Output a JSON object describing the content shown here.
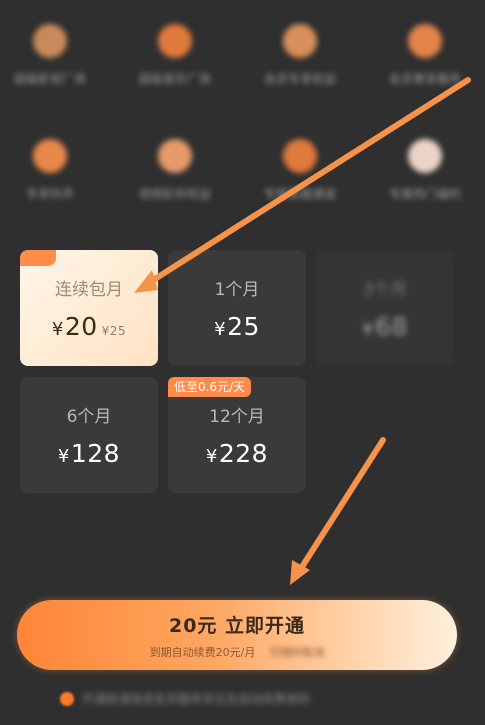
{
  "benefits": [
    {
      "label": "超级影视厂商",
      "color": "#c88a5a"
    },
    {
      "label": "超级音乐厂商",
      "color": "#e07a3c"
    },
    {
      "label": "会员专享权益",
      "color": "#d98f5a"
    },
    {
      "label": "会员尊享服务",
      "color": "#e3834a"
    },
    {
      "label": "专享铃声",
      "color": "#e8874a"
    },
    {
      "label": "视频彩铃权益",
      "color": "#e69a6a"
    },
    {
      "label": "专属客服通道",
      "color": "#e07a3c"
    },
    {
      "label": "专属热门福利",
      "color": "#ead4c6"
    }
  ],
  "plans": [
    {
      "name": "连续包月",
      "currency": "¥",
      "price": "20",
      "original": "¥25"
    },
    {
      "name": "1个月",
      "currency": "¥",
      "price": "25"
    },
    {
      "name": "3个月",
      "currency": "¥",
      "price": "68"
    },
    {
      "name": "6个月",
      "currency": "¥",
      "price": "128"
    },
    {
      "name": "12个月",
      "currency": "¥",
      "price": "228"
    }
  ],
  "promo_badge": "低至0.6元/天",
  "cta": {
    "main": "20元 立即开通",
    "sub": "到期自动续费20元/月",
    "sub_blurred": "可随时取消"
  },
  "agreement": "开通前请阅读会员服务协议及自动续费规则",
  "colors": {
    "accent": "#ff8537",
    "arrow": "#f5934a",
    "background": "#2f2f2f",
    "card": "#3a3a3a"
  }
}
